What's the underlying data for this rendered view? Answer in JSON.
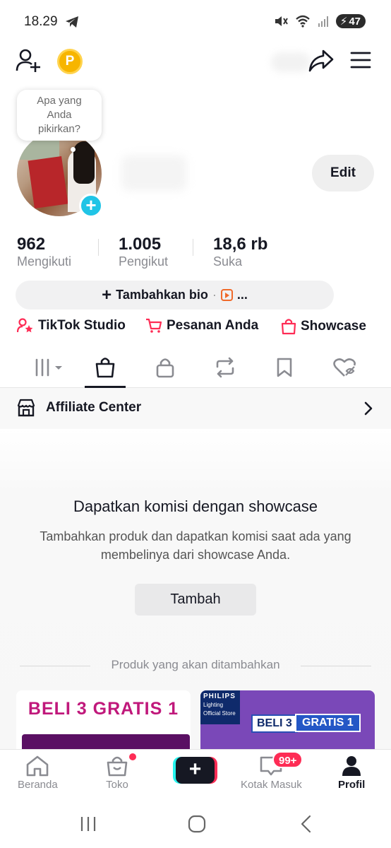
{
  "status_bar": {
    "time": "18.29",
    "battery": "47"
  },
  "note_bubble": {
    "line1": "Apa yang",
    "line2": "Anda",
    "line3": "pikirkan?"
  },
  "profile": {
    "edit_label": "Edit"
  },
  "stats": [
    {
      "value": "962",
      "label": "Mengikuti"
    },
    {
      "value": "1.005",
      "label": "Pengikut"
    },
    {
      "value": "18,6 rb",
      "label": "Suka"
    }
  ],
  "bio": {
    "add_label": "Tambahkan bio",
    "separator": "·",
    "more": "..."
  },
  "links": [
    {
      "label": "TikTok Studio",
      "icon": "person-star-icon"
    },
    {
      "label": "Pesanan Anda",
      "icon": "cart-icon"
    },
    {
      "label": "Showcase",
      "icon": "bag-icon"
    }
  ],
  "tabs": [
    "grid-icon",
    "bag-icon",
    "lock-icon",
    "repost-icon",
    "bookmark-icon",
    "heart-hidden-icon"
  ],
  "affiliate": {
    "label": "Affiliate Center"
  },
  "empty_state": {
    "title": "Dapatkan komisi dengan showcase",
    "description": "Tambahkan produk dan dapatkan komisi saat ada yang membelinya dari showcase Anda.",
    "button": "Tambah",
    "section_label": "Produk yang akan ditambahkan"
  },
  "products": [
    {
      "promo": "BELI 3 GRATIS 1"
    },
    {
      "brand": "PHILIPS",
      "brand_sub1": "Lighting",
      "brand_sub2": "Official Store",
      "beli": "BELI 3",
      "gratis": "GRATIS 1"
    }
  ],
  "bottom_nav": {
    "home": "Beranda",
    "shop": "Toko",
    "create": "+",
    "inbox": "Kotak Masuk",
    "inbox_badge": "99+",
    "profile": "Profil"
  },
  "colors": {
    "accent_red": "#fe2c55",
    "accent_cyan": "#25f4ee",
    "avatar_add": "#20c4e6"
  }
}
